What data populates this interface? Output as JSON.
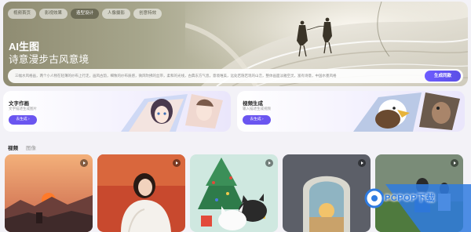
{
  "hero": {
    "tabs": [
      {
        "label": "视频首页",
        "active": false
      },
      {
        "label": "影视效果",
        "active": false
      },
      {
        "label": "造型设计",
        "active": true
      },
      {
        "label": "人像摄影",
        "active": false
      },
      {
        "label": "创意特效",
        "active": false
      }
    ],
    "title": "AI生图",
    "subtitle": "诗意漫步古风意境",
    "prompt_text": "三幅水风格画，两个小人物在轻薄的纱布上行走，画风古韵，细致的纱布质感，微风吹拂的丝带，柔和的光线，古典东方气息，意境唯美，远处若隐若现的山峦，整体画面淡雅空灵，富有诗意，中国水墨风格",
    "generate_button": "生成同款"
  },
  "features": [
    {
      "title": "文字作画",
      "desc": "文字描述生成图片",
      "button": "去生成 ›"
    },
    {
      "title": "视频生成",
      "desc": "输入描述生成视频",
      "button": "去生成 ›"
    }
  ],
  "media_tabs": [
    {
      "label": "视频",
      "active": true
    },
    {
      "label": "图像",
      "active": false
    }
  ],
  "gallery": [
    {
      "name": "sunset-great-wall"
    },
    {
      "name": "girl-in-white-coat"
    },
    {
      "name": "christmas-cats"
    },
    {
      "name": "arch-sunset"
    },
    {
      "name": "soccer-players"
    }
  ],
  "watermark": {
    "text": "PCPOP下载",
    "color": "#2f7be0"
  }
}
